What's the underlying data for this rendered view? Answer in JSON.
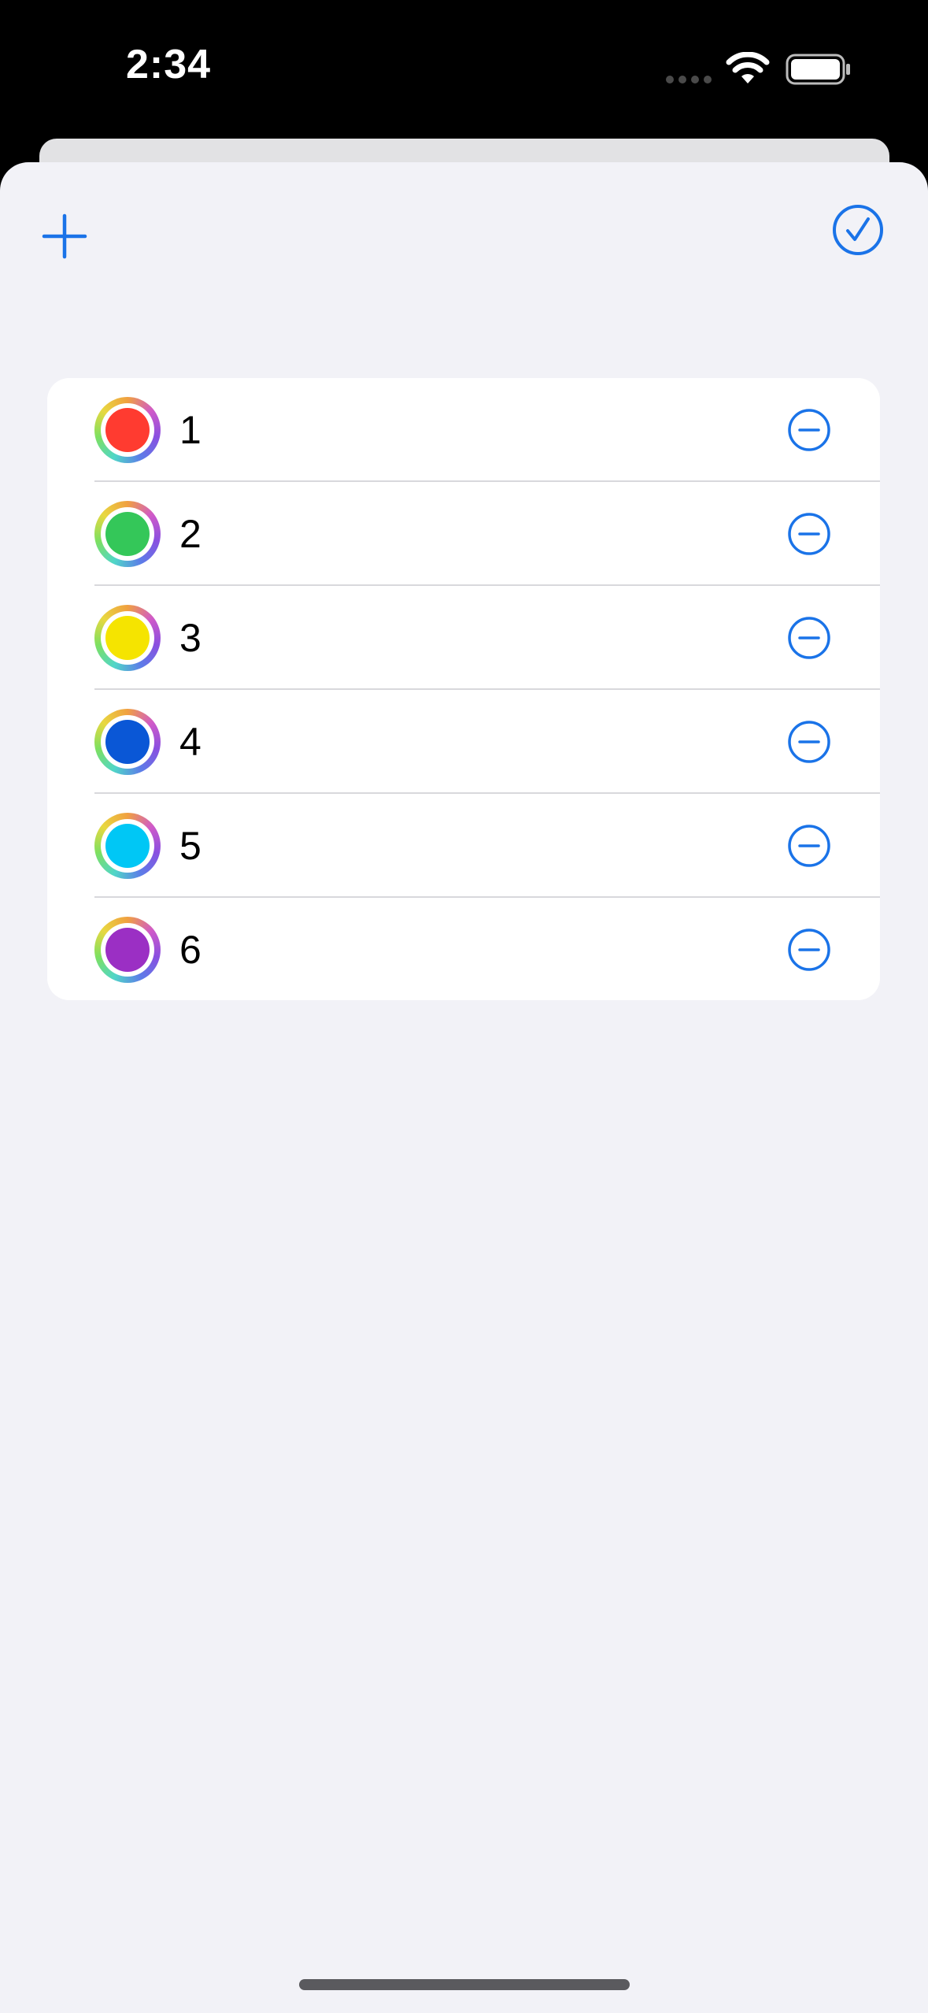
{
  "status_bar": {
    "time": "2:34",
    "icons": [
      "signal-dots-icon",
      "wifi-icon",
      "battery-icon"
    ]
  },
  "toolbar": {
    "add_icon": "plus-icon",
    "done_icon": "checkmark-circle-icon"
  },
  "colors": {
    "accent": "#1a73e8",
    "sheet_background": "#f2f2f7",
    "card_background": "#ffffff"
  },
  "items": [
    {
      "label": "1",
      "color": "#ff3b30"
    },
    {
      "label": "2",
      "color": "#34c759"
    },
    {
      "label": "3",
      "color": "#f5e400"
    },
    {
      "label": "4",
      "color": "#0a57d6"
    },
    {
      "label": "5",
      "color": "#00c7f5"
    },
    {
      "label": "6",
      "color": "#9b2fc4"
    }
  ],
  "row_action_icon": "minus-circle-icon"
}
